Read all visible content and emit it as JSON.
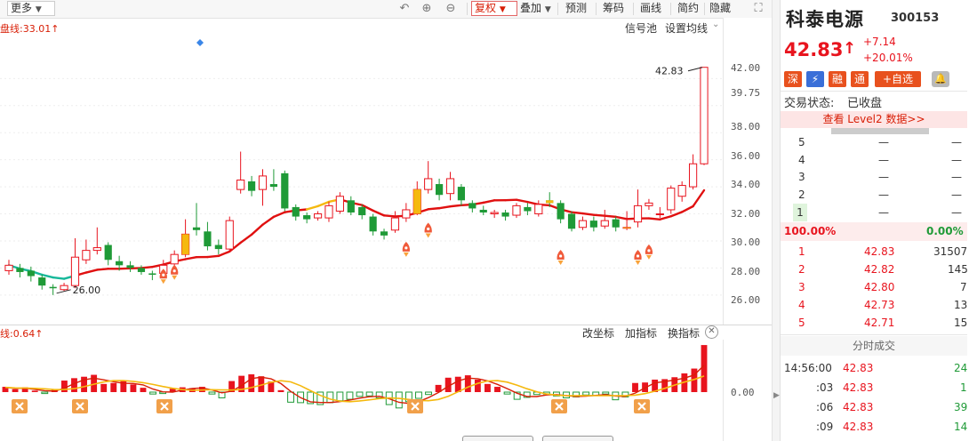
{
  "toolbar": {
    "more_label": "更多",
    "fuquan_label": "复权",
    "diejia_label": "叠加",
    "yuce_label": "预测",
    "chouma_label": "筹码",
    "huaxian_label": "画线",
    "jianyue_label": "简约",
    "yincang_label": "隐藏"
  },
  "main_chart": {
    "ma_label": "盘线:33.01↑",
    "signal_pool_label": "信号池",
    "set_ma_label": "设置均线",
    "high_marker": "42.83",
    "low_marker": "26.00",
    "price_labels": [
      "42.00",
      "39.75",
      "38.00",
      "36.00",
      "34.00",
      "32.00",
      "30.00",
      "28.00",
      "26.00"
    ]
  },
  "sub_chart": {
    "indicator_label": "线:0.64↑",
    "gaizuobiao_label": "改坐标",
    "jiazhibiao_label": "加指标",
    "huanzhibiao_label": "换指标",
    "zero_label": "0.00"
  },
  "chart_data": {
    "type": "candlestick",
    "title": "",
    "ylim": [
      25.2,
      43.6
    ],
    "note_values": {
      "high": 42.83,
      "low": 26.0
    },
    "candles": [
      {
        "o": 27.8,
        "c": 28.2,
        "h": 28.6,
        "l": 27.5
      },
      {
        "o": 28.0,
        "c": 27.7,
        "h": 28.3,
        "l": 27.3
      },
      {
        "o": 27.8,
        "c": 27.4,
        "h": 28.1,
        "l": 27.0
      },
      {
        "o": 27.3,
        "c": 26.7,
        "h": 27.5,
        "l": 26.4
      },
      {
        "o": 26.6,
        "c": 26.5,
        "h": 26.8,
        "l": 26.0
      },
      {
        "o": 26.4,
        "c": 26.7,
        "h": 26.9,
        "l": 26.3
      },
      {
        "o": 26.7,
        "c": 28.8,
        "h": 30.2,
        "l": 26.5
      },
      {
        "o": 28.6,
        "c": 29.3,
        "h": 30.1,
        "l": 28.3
      },
      {
        "o": 29.3,
        "c": 29.5,
        "h": 31.0,
        "l": 29.0
      },
      {
        "o": 29.7,
        "c": 28.6,
        "h": 29.9,
        "l": 28.2
      },
      {
        "o": 28.5,
        "c": 28.2,
        "h": 28.9,
        "l": 27.8
      },
      {
        "o": 28.2,
        "c": 28.0,
        "h": 28.5,
        "l": 27.7
      },
      {
        "o": 28.0,
        "c": 27.7,
        "h": 28.2,
        "l": 27.5
      },
      {
        "o": 27.6,
        "c": 27.5,
        "h": 27.8,
        "l": 27.1
      },
      {
        "o": 27.6,
        "c": 28.2,
        "h": 28.6,
        "l": 27.3
      },
      {
        "o": 28.3,
        "c": 29.0,
        "h": 29.3,
        "l": 27.9
      },
      {
        "o": 29.0,
        "c": 30.5,
        "h": 31.6,
        "l": 28.8
      },
      {
        "o": 31.0,
        "c": 30.8,
        "h": 32.8,
        "l": 30.4
      },
      {
        "o": 30.7,
        "c": 29.6,
        "h": 31.4,
        "l": 29.3
      },
      {
        "o": 29.7,
        "c": 29.4,
        "h": 30.1,
        "l": 29.0
      },
      {
        "o": 29.4,
        "c": 31.5,
        "h": 31.8,
        "l": 29.2
      },
      {
        "o": 33.8,
        "c": 34.5,
        "h": 36.6,
        "l": 33.5
      },
      {
        "o": 34.4,
        "c": 33.7,
        "h": 34.8,
        "l": 33.3
      },
      {
        "o": 33.8,
        "c": 34.8,
        "h": 35.3,
        "l": 32.6
      },
      {
        "o": 34.2,
        "c": 34.0,
        "h": 35.3,
        "l": 33.7
      },
      {
        "o": 35.0,
        "c": 32.4,
        "h": 35.2,
        "l": 32.2
      },
      {
        "o": 32.5,
        "c": 31.8,
        "h": 32.7,
        "l": 31.5
      },
      {
        "o": 31.9,
        "c": 31.6,
        "h": 32.1,
        "l": 31.3
      },
      {
        "o": 31.7,
        "c": 32.0,
        "h": 32.2,
        "l": 31.5
      },
      {
        "o": 31.7,
        "c": 32.6,
        "h": 32.9,
        "l": 31.4
      },
      {
        "o": 32.2,
        "c": 33.3,
        "h": 33.6,
        "l": 32.0
      },
      {
        "o": 33.0,
        "c": 32.1,
        "h": 33.3,
        "l": 31.9
      },
      {
        "o": 32.5,
        "c": 31.9,
        "h": 32.7,
        "l": 31.6
      },
      {
        "o": 31.8,
        "c": 30.7,
        "h": 32.0,
        "l": 30.4
      },
      {
        "o": 30.7,
        "c": 30.4,
        "h": 30.9,
        "l": 30.1
      },
      {
        "o": 30.8,
        "c": 31.7,
        "h": 32.2,
        "l": 30.6
      },
      {
        "o": 31.7,
        "c": 32.3,
        "h": 32.8,
        "l": 31.4
      },
      {
        "o": 32.0,
        "c": 33.8,
        "h": 34.4,
        "l": 31.9
      },
      {
        "o": 33.8,
        "c": 34.6,
        "h": 35.9,
        "l": 33.5
      },
      {
        "o": 34.2,
        "c": 33.4,
        "h": 34.6,
        "l": 33.0
      },
      {
        "o": 33.5,
        "c": 34.6,
        "h": 35.1,
        "l": 33.0
      },
      {
        "o": 34.0,
        "c": 33.0,
        "h": 34.2,
        "l": 32.6
      },
      {
        "o": 32.8,
        "c": 32.4,
        "h": 33.0,
        "l": 32.1
      },
      {
        "o": 32.3,
        "c": 32.1,
        "h": 32.6,
        "l": 31.9
      },
      {
        "o": 32.0,
        "c": 32.1,
        "h": 32.3,
        "l": 31.7
      },
      {
        "o": 32.1,
        "c": 31.8,
        "h": 32.3,
        "l": 31.5
      },
      {
        "o": 31.9,
        "c": 32.6,
        "h": 32.8,
        "l": 31.7
      },
      {
        "o": 32.5,
        "c": 32.2,
        "h": 32.8,
        "l": 31.9
      },
      {
        "o": 32.0,
        "c": 32.7,
        "h": 33.0,
        "l": 31.8
      },
      {
        "o": 33.0,
        "c": 32.8,
        "h": 33.6,
        "l": 32.5
      },
      {
        "o": 32.8,
        "c": 31.6,
        "h": 33.0,
        "l": 31.3
      },
      {
        "o": 32.0,
        "c": 30.9,
        "h": 32.2,
        "l": 30.7
      },
      {
        "o": 31.0,
        "c": 31.5,
        "h": 31.8,
        "l": 30.8
      },
      {
        "o": 31.5,
        "c": 31.0,
        "h": 31.8,
        "l": 30.7
      },
      {
        "o": 31.1,
        "c": 31.5,
        "h": 32.3,
        "l": 30.9
      },
      {
        "o": 31.6,
        "c": 31.0,
        "h": 31.8,
        "l": 30.7
      },
      {
        "o": 31.0,
        "c": 31.0,
        "h": 32.2,
        "l": 30.8
      },
      {
        "o": 31.4,
        "c": 32.6,
        "h": 33.8,
        "l": 31.0
      },
      {
        "o": 32.6,
        "c": 32.8,
        "h": 33.1,
        "l": 32.3
      },
      {
        "o": 32.0,
        "c": 32.0,
        "h": 32.5,
        "l": 31.7
      },
      {
        "o": 32.3,
        "c": 33.9,
        "h": 34.1,
        "l": 32.0
      },
      {
        "o": 33.3,
        "c": 34.1,
        "h": 34.4,
        "l": 32.9
      },
      {
        "o": 34.0,
        "c": 35.7,
        "h": 36.4,
        "l": 33.8
      },
      {
        "o": 35.7,
        "c": 42.83,
        "h": 42.83,
        "l": 35.6
      }
    ],
    "sub_bars": [
      1.1,
      0.6,
      1.0,
      0.3,
      -0.3,
      0.6,
      2.4,
      2.9,
      3.2,
      3.6,
      1.7,
      1.9,
      2.5,
      1.6,
      0.9,
      -0.4,
      -0.3,
      0.7,
      1.0,
      0.8,
      1.1,
      -0.4,
      -1.2,
      2.3,
      3.4,
      3.7,
      3.3,
      2.2,
      0.4,
      -2.1,
      -2.2,
      -2.4,
      -2.6,
      -2.2,
      -1.8,
      -1.5,
      -0.9,
      -0.8,
      -1.2,
      -2.6,
      -3.3,
      -2.0,
      -1.3,
      -0.5,
      1.5,
      3.0,
      3.2,
      3.5,
      2.6,
      1.7,
      1.1,
      -0.4,
      -1.5,
      -1.1,
      -0.5,
      -0.4,
      -0.8,
      -1.2,
      -1.0,
      -0.6,
      -0.7,
      -0.4,
      -1.6,
      -1.0,
      1.9,
      2.0,
      2.6,
      2.7,
      3.1,
      3.9,
      4.9,
      9.8
    ]
  },
  "stock": {
    "name": "科泰电源",
    "code": "300153",
    "price": "42.83",
    "arrow": "↑",
    "change": "+7.14",
    "change_pct": "+20.01%",
    "badges": {
      "shen": "深",
      "flash": "⚡",
      "rong": "融",
      "tong": "通",
      "add": "+自选"
    },
    "status_label": "交易状态:",
    "status_value": "已收盘",
    "level2_link": "查看 Level2 数据>>",
    "sell_levels": [
      {
        "label": "5",
        "price": "—",
        "vol": "—"
      },
      {
        "label": "4",
        "price": "—",
        "vol": "—"
      },
      {
        "label": "3",
        "price": "—",
        "vol": "—"
      },
      {
        "label": "2",
        "price": "—",
        "vol": "—"
      },
      {
        "label": "1",
        "price": "—",
        "vol": "—"
      }
    ],
    "ratio_left": "100.00%",
    "ratio_right": "0.00%",
    "buy_levels": [
      {
        "label": "1",
        "price": "42.83",
        "vol": "31507"
      },
      {
        "label": "2",
        "price": "42.82",
        "vol": "145"
      },
      {
        "label": "3",
        "price": "42.80",
        "vol": "7"
      },
      {
        "label": "4",
        "price": "42.73",
        "vol": "13"
      },
      {
        "label": "5",
        "price": "42.71",
        "vol": "15"
      }
    ],
    "ticks_title": "分时成交",
    "ticks": [
      {
        "time": "14:56:00",
        "price": "42.83",
        "vol": "24"
      },
      {
        "time": ":03",
        "price": "42.83",
        "vol": "1"
      },
      {
        "time": ":06",
        "price": "42.83",
        "vol": "39"
      },
      {
        "time": ":09",
        "price": "42.83",
        "vol": "14"
      }
    ]
  },
  "colors": {
    "up": "#e8141e",
    "down": "#1f9a37",
    "yellow": "#f5b90f",
    "ma": "#e01010",
    "teal": "#17b89a",
    "orange": "#f1a04a"
  }
}
